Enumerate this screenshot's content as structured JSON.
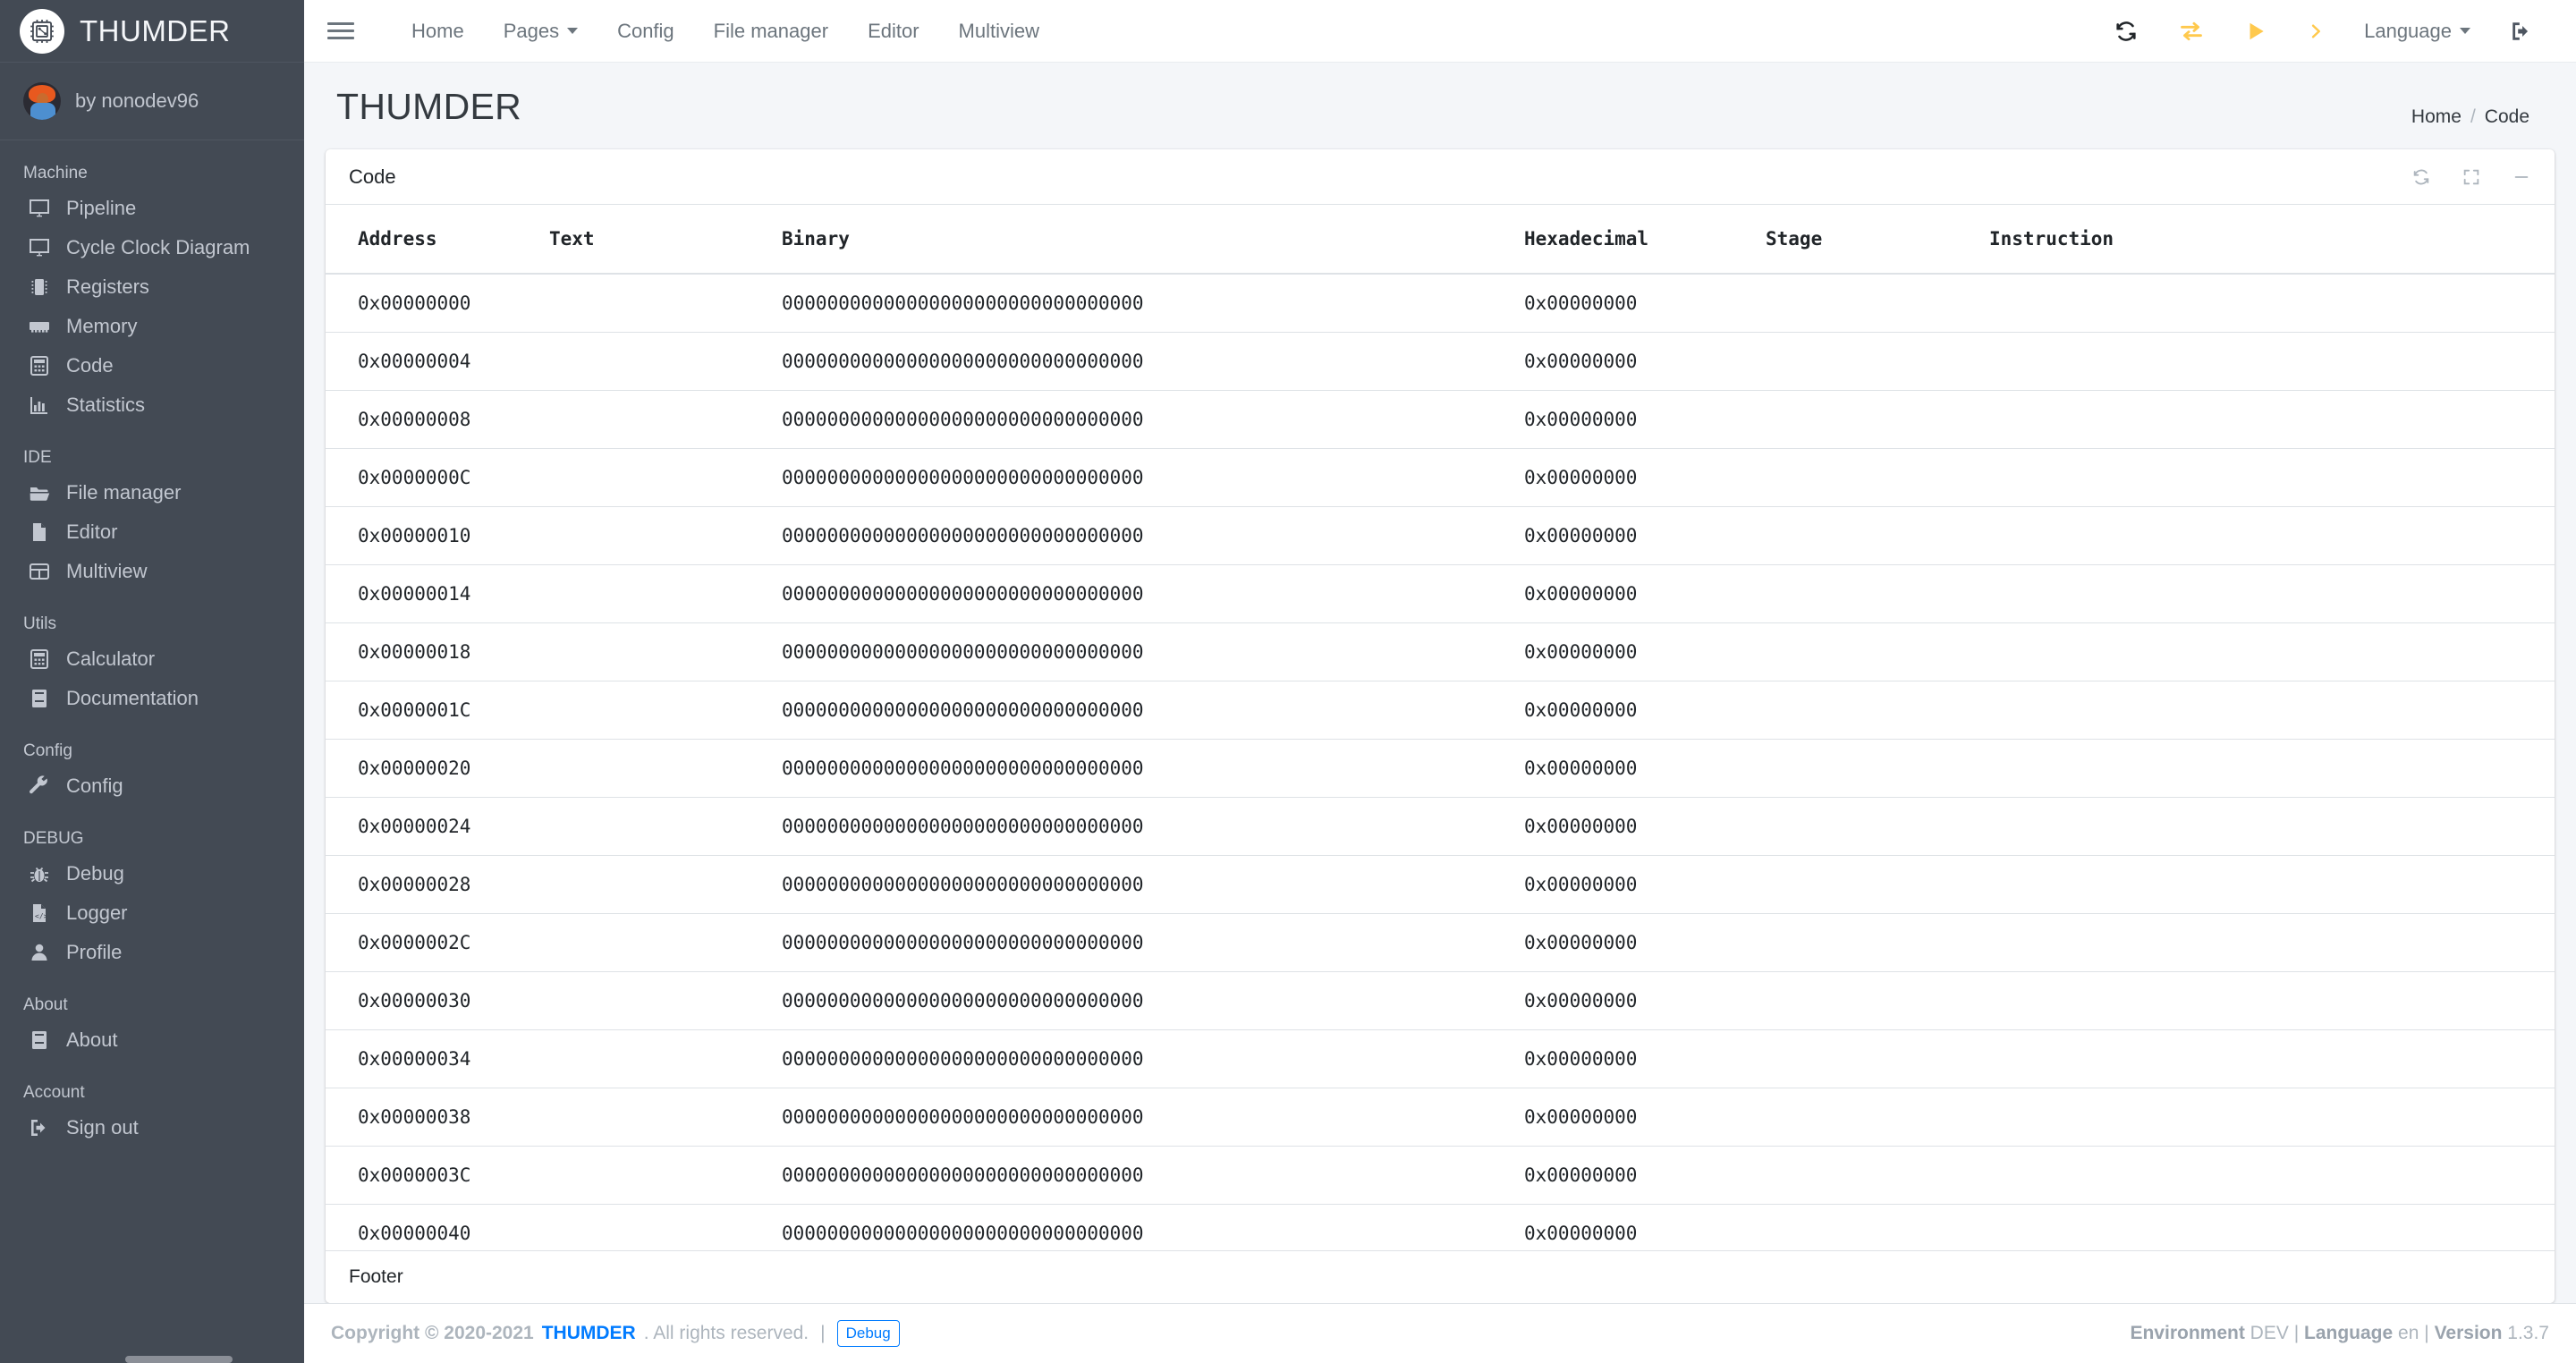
{
  "brand": {
    "title": "THUMDER",
    "logo_icon": "cpu-chip-icon"
  },
  "user": {
    "name": "by nonodev96",
    "avatar_icon": "user-avatar"
  },
  "sidebar": {
    "sections": [
      {
        "header": "Machine",
        "items": [
          {
            "label": "Pipeline",
            "icon": "desktop-icon"
          },
          {
            "label": "Cycle Clock Diagram",
            "icon": "desktop-icon"
          },
          {
            "label": "Registers",
            "icon": "memory-chip-icon"
          },
          {
            "label": "Memory",
            "icon": "memory-stick-icon"
          },
          {
            "label": "Code",
            "icon": "calculator-icon"
          },
          {
            "label": "Statistics",
            "icon": "chart-bar-icon"
          }
        ]
      },
      {
        "header": "IDE",
        "items": [
          {
            "label": "File manager",
            "icon": "folder-open-icon"
          },
          {
            "label": "Editor",
            "icon": "file-icon"
          },
          {
            "label": "Multiview",
            "icon": "table-grid-icon"
          }
        ]
      },
      {
        "header": "Utils",
        "items": [
          {
            "label": "Calculator",
            "icon": "calculator-icon"
          },
          {
            "label": "Documentation",
            "icon": "book-icon"
          }
        ]
      },
      {
        "header": "Config",
        "items": [
          {
            "label": "Config",
            "icon": "wrench-icon"
          }
        ]
      },
      {
        "header": "DEBUG",
        "items": [
          {
            "label": "Debug",
            "icon": "bug-icon"
          },
          {
            "label": "Logger",
            "icon": "file-code-icon"
          },
          {
            "label": "Profile",
            "icon": "user-icon"
          }
        ]
      },
      {
        "header": "About",
        "items": [
          {
            "label": "About",
            "icon": "book-icon"
          }
        ]
      },
      {
        "header": "Account",
        "items": [
          {
            "label": "Sign out",
            "icon": "sign-out-icon"
          }
        ]
      }
    ]
  },
  "topnav": {
    "menu_icon": "hamburger-icon",
    "links": [
      {
        "label": "Home",
        "has_caret": false
      },
      {
        "label": "Pages",
        "has_caret": true
      },
      {
        "label": "Config",
        "has_caret": false
      },
      {
        "label": "File manager",
        "has_caret": false
      },
      {
        "label": "Editor",
        "has_caret": false
      },
      {
        "label": "Multiview",
        "has_caret": false
      }
    ],
    "icons": [
      {
        "name": "sync-reset-icon",
        "color": "#212529"
      },
      {
        "name": "exchange-step-icon",
        "color": "#ffc94d"
      },
      {
        "name": "play-run-icon",
        "color": "#ffc94d"
      },
      {
        "name": "chevron-right-step-icon",
        "color": "#ffc94d"
      }
    ],
    "language_label": "Language",
    "signout_icon": "sign-out-icon"
  },
  "header": {
    "page_title": "THUMDER",
    "breadcrumb": [
      "Home",
      "Code"
    ],
    "breadcrumb_separator": "/"
  },
  "card": {
    "title": "Code",
    "tools": [
      {
        "name": "refresh-icon"
      },
      {
        "name": "expand-icon"
      },
      {
        "name": "minimize-icon"
      }
    ],
    "footer_label": "Footer"
  },
  "table": {
    "columns": [
      "Address",
      "Text",
      "Binary",
      "Hexadecimal",
      "Stage",
      "Instruction"
    ],
    "rows": [
      {
        "address": "0x00000000",
        "text": "",
        "binary": "00000000000000000000000000000000",
        "hexadecimal": "0x00000000",
        "stage": "",
        "instruction": ""
      },
      {
        "address": "0x00000004",
        "text": "",
        "binary": "00000000000000000000000000000000",
        "hexadecimal": "0x00000000",
        "stage": "",
        "instruction": ""
      },
      {
        "address": "0x00000008",
        "text": "",
        "binary": "00000000000000000000000000000000",
        "hexadecimal": "0x00000000",
        "stage": "",
        "instruction": ""
      },
      {
        "address": "0x0000000C",
        "text": "",
        "binary": "00000000000000000000000000000000",
        "hexadecimal": "0x00000000",
        "stage": "",
        "instruction": ""
      },
      {
        "address": "0x00000010",
        "text": "",
        "binary": "00000000000000000000000000000000",
        "hexadecimal": "0x00000000",
        "stage": "",
        "instruction": ""
      },
      {
        "address": "0x00000014",
        "text": "",
        "binary": "00000000000000000000000000000000",
        "hexadecimal": "0x00000000",
        "stage": "",
        "instruction": ""
      },
      {
        "address": "0x00000018",
        "text": "",
        "binary": "00000000000000000000000000000000",
        "hexadecimal": "0x00000000",
        "stage": "",
        "instruction": ""
      },
      {
        "address": "0x0000001C",
        "text": "",
        "binary": "00000000000000000000000000000000",
        "hexadecimal": "0x00000000",
        "stage": "",
        "instruction": ""
      },
      {
        "address": "0x00000020",
        "text": "",
        "binary": "00000000000000000000000000000000",
        "hexadecimal": "0x00000000",
        "stage": "",
        "instruction": ""
      },
      {
        "address": "0x00000024",
        "text": "",
        "binary": "00000000000000000000000000000000",
        "hexadecimal": "0x00000000",
        "stage": "",
        "instruction": ""
      },
      {
        "address": "0x00000028",
        "text": "",
        "binary": "00000000000000000000000000000000",
        "hexadecimal": "0x00000000",
        "stage": "",
        "instruction": ""
      },
      {
        "address": "0x0000002C",
        "text": "",
        "binary": "00000000000000000000000000000000",
        "hexadecimal": "0x00000000",
        "stage": "",
        "instruction": ""
      },
      {
        "address": "0x00000030",
        "text": "",
        "binary": "00000000000000000000000000000000",
        "hexadecimal": "0x00000000",
        "stage": "",
        "instruction": ""
      },
      {
        "address": "0x00000034",
        "text": "",
        "binary": "00000000000000000000000000000000",
        "hexadecimal": "0x00000000",
        "stage": "",
        "instruction": ""
      },
      {
        "address": "0x00000038",
        "text": "",
        "binary": "00000000000000000000000000000000",
        "hexadecimal": "0x00000000",
        "stage": "",
        "instruction": ""
      },
      {
        "address": "0x0000003C",
        "text": "",
        "binary": "00000000000000000000000000000000",
        "hexadecimal": "0x00000000",
        "stage": "",
        "instruction": ""
      },
      {
        "address": "0x00000040",
        "text": "",
        "binary": "00000000000000000000000000000000",
        "hexadecimal": "0x00000000",
        "stage": "",
        "instruction": ""
      }
    ]
  },
  "footer": {
    "copyright_prefix": "Copyright © 2020-2021",
    "brand": "THUMDER",
    "copyright_suffix": ". All rights reserved.",
    "pipe": "|",
    "debug_badge": "Debug",
    "env_label": "Environment",
    "env_value": "DEV",
    "lang_label": "Language",
    "lang_value": "en",
    "version_label": "Version",
    "version_value": "1.3.7",
    "sep": "|"
  },
  "colors": {
    "sidebar_bg": "#434a54",
    "accent_yellow": "#ffc94d",
    "link_blue": "#007bff",
    "page_bg": "#f4f6f9",
    "muted": "#adb5bd"
  }
}
